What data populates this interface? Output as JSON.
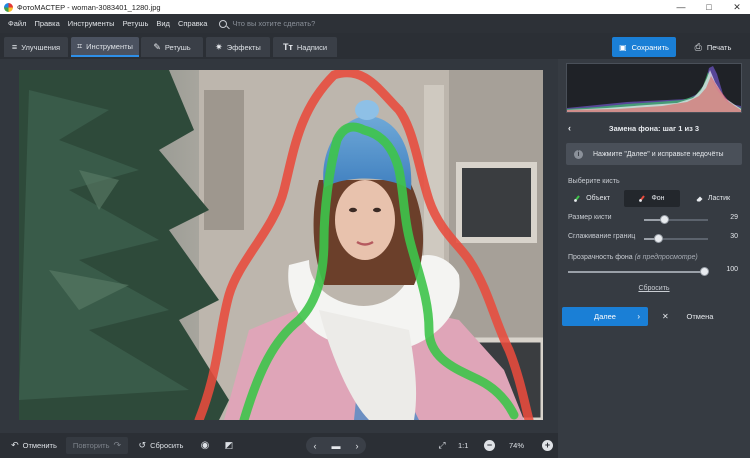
{
  "window": {
    "title": "ФотоМАСТЕР - woman-3083401_1280.jpg"
  },
  "menu": {
    "items": [
      "Файл",
      "Правка",
      "Инструменты",
      "Ретушь",
      "Вид",
      "Справка"
    ],
    "search_placeholder": "Что вы хотите сделать?"
  },
  "tabs": [
    {
      "label": "Улучшения",
      "icon": "sliders-icon"
    },
    {
      "label": "Инструменты",
      "icon": "crop-icon",
      "active": true
    },
    {
      "label": "Ретушь",
      "icon": "brush-icon"
    },
    {
      "label": "Эффекты",
      "icon": "magic-wand-icon"
    },
    {
      "label": "Надписи",
      "icon": "text-icon"
    }
  ],
  "toolbar": {
    "save_label": "Сохранить",
    "print_label": "Печать"
  },
  "panel": {
    "step_title": "Замена фона: шаг 1 из 3",
    "hint": "Нажмите \"Далее\" и исправьте недочёты",
    "brush_label": "Выберите кисть",
    "brushes": [
      {
        "label": "Объект",
        "color": "#3ec44a"
      },
      {
        "label": "Фон",
        "color": "#e84b3c",
        "selected": true
      },
      {
        "label": "Ластик",
        "color": "#e8ebef"
      }
    ],
    "brush_size": {
      "label": "Размер кисти",
      "value": "29",
      "fraction": 0.53
    },
    "smoothing": {
      "label": "Сглаживание границ",
      "value": "30",
      "fraction": 0.5
    },
    "opacity_label": "Прозрачность фона",
    "opacity_note": "(в предпросмотре)",
    "opacity": {
      "value": "100",
      "fraction": 1.0
    },
    "reset_label": "Сбросить",
    "next_label": "Далее",
    "cancel_label": "Отмена"
  },
  "bottom": {
    "undo_label": "Отменить",
    "redo_label": "Повторить",
    "reset_label": "Сбросить",
    "ratio_label": "1:1",
    "zoom": "74%"
  },
  "colors": {
    "accent": "#1a7fd6",
    "object_stroke": "#3ec44a",
    "background_stroke": "#e84b3c"
  }
}
